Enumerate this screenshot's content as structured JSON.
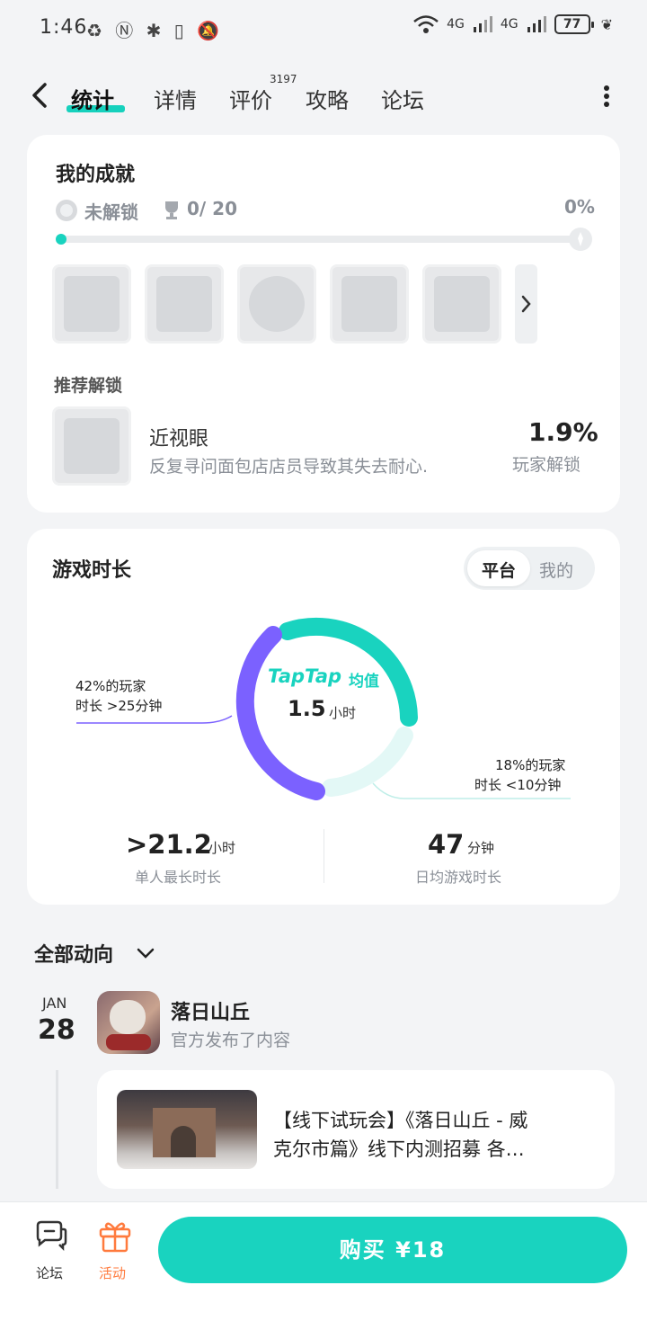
{
  "status_bar": {
    "time": "1:46",
    "left_icons": "♻ Ⓝ ✱ ▯ 🔕",
    "net1": "4G",
    "net2": "4G",
    "battery": "77"
  },
  "nav": {
    "tabs": [
      {
        "label": "统计"
      },
      {
        "label": "详情"
      },
      {
        "label": "评价"
      },
      {
        "label": "攻略"
      },
      {
        "label": "论坛"
      }
    ],
    "review_count": "3197"
  },
  "achievements": {
    "title": "我的成就",
    "status_label": "未解锁",
    "count": "0/ 20",
    "percent": "0%",
    "progress": 0,
    "recommend_title": "推荐解锁",
    "recommend": {
      "name": "近视眼",
      "description": "反复寻问面包店店员导致其失去耐心.",
      "rate": "1.9%",
      "rate_label": "玩家解锁"
    }
  },
  "playtime": {
    "title": "游戏时长",
    "toggle": [
      "平台",
      "我的"
    ],
    "brand": "TapTap",
    "avg_label": "均值",
    "avg_value": "1.5",
    "avg_unit": "小时",
    "left_note_1": "42%的玩家",
    "left_note_2": "时长 >25分钟",
    "right_note_1": "18%的玩家",
    "right_note_2": "时长 <10分钟",
    "stat1_value": ">21.2",
    "stat1_unit": "小时",
    "stat1_label": "单人最长时长",
    "stat2_value": "47",
    "stat2_unit": "分钟",
    "stat2_label": "日均游戏时长",
    "colors": {
      "purple": "#7b61ff",
      "teal": "#19d3bf",
      "light": "#e3f8f6"
    }
  },
  "feed": {
    "filter": "全部动向",
    "month": "JAN",
    "day": "28",
    "author": "落日山丘",
    "action": "官方发布了内容",
    "post_line1": "【线下试玩会】《落日山丘 - 威",
    "post_line2": "克尔市篇》线下内测招募 各…"
  },
  "bottom": {
    "forum": "论坛",
    "activity": "活动",
    "buy": "购买 ¥18"
  }
}
